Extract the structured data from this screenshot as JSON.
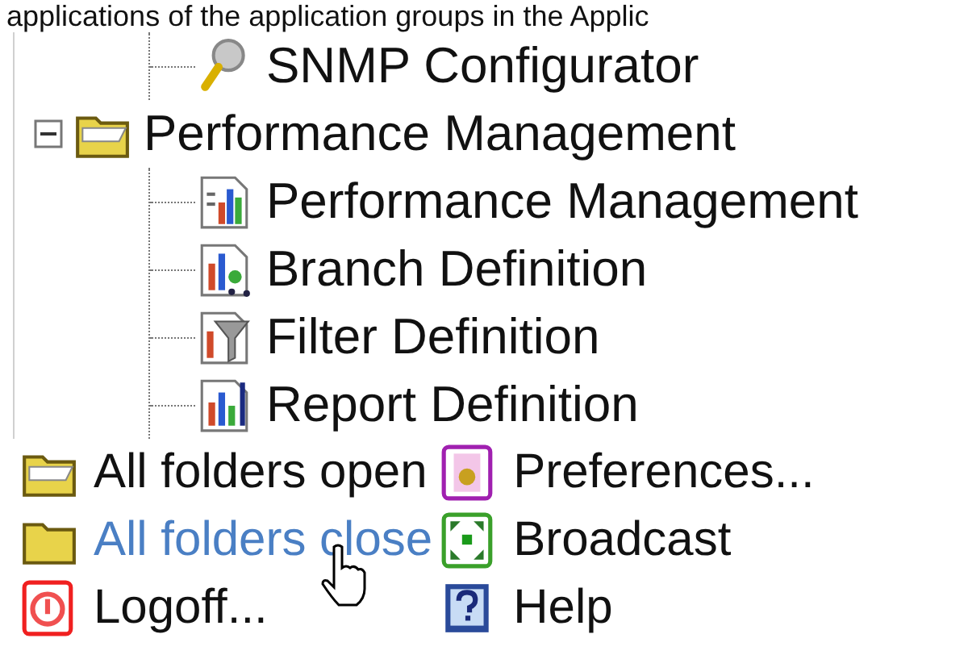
{
  "intro": "applications of the application groups in the Applic",
  "tree": [
    {
      "kind": "tool",
      "label": "SNMP Configurator"
    },
    {
      "kind": "folder",
      "label": "Performance Management",
      "expanded": true,
      "children": [
        {
          "kind": "chart",
          "label": "Performance Management"
        },
        {
          "kind": "branch",
          "label": "Branch Definition"
        },
        {
          "kind": "filter",
          "label": "Filter Definition"
        },
        {
          "kind": "report",
          "label": "Report Definition"
        }
      ]
    }
  ],
  "actions": [
    {
      "kind": "folder_open",
      "label": "All folders open",
      "hovered": false
    },
    {
      "kind": "preferences",
      "label": "Preferences...",
      "hovered": false
    },
    {
      "kind": "folder_closed",
      "label": "All folders close",
      "hovered": true
    },
    {
      "kind": "broadcast",
      "label": "Broadcast",
      "hovered": false
    },
    {
      "kind": "logoff",
      "label": "Logoff...",
      "hovered": false
    },
    {
      "kind": "help",
      "label": "Help",
      "hovered": false
    }
  ]
}
